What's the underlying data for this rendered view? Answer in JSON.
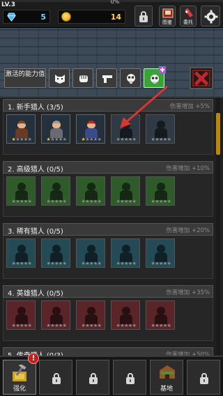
{
  "header": {
    "level": "LV.3",
    "xp_percent_text": "0%",
    "gems": "5",
    "coins": "14",
    "atlas_label": "图鉴",
    "commission_label": "委托"
  },
  "ability_tabs": {
    "active_label": "激活的能力值",
    "icons": [
      "cat-face-icon",
      "fist-icon",
      "pistol-icon",
      "gas-mask-icon",
      "gas-mask-plus-icon"
    ],
    "active_index": 4
  },
  "sections": [
    {
      "title": "1. 新手猎人 (3/5)",
      "bonus": "伤害增加 +5%",
      "color": "#2f3a45",
      "owned": 3,
      "total": 5
    },
    {
      "title": "2. 高级猎人 (0/5)",
      "bonus": "伤害增加 +10%",
      "color": "#2f5a2a",
      "owned": 0,
      "total": 5
    },
    {
      "title": "3. 稀有猎人 (0/5)",
      "bonus": "伤害增加 +20%",
      "color": "#234a55",
      "owned": 0,
      "total": 5
    },
    {
      "title": "4. 英雄猎人 (0/5)",
      "bonus": "伤害增加 +35%",
      "color": "#5a2528",
      "owned": 0,
      "total": 5
    },
    {
      "title": "5. 传奇猎人 (0/3)",
      "bonus": "伤害增加 +50%",
      "color": "#5a4a20",
      "owned": 0,
      "total": 3
    }
  ],
  "bottom_nav": {
    "upgrade_label": "强化",
    "base_label": "基地",
    "badge": "!"
  }
}
